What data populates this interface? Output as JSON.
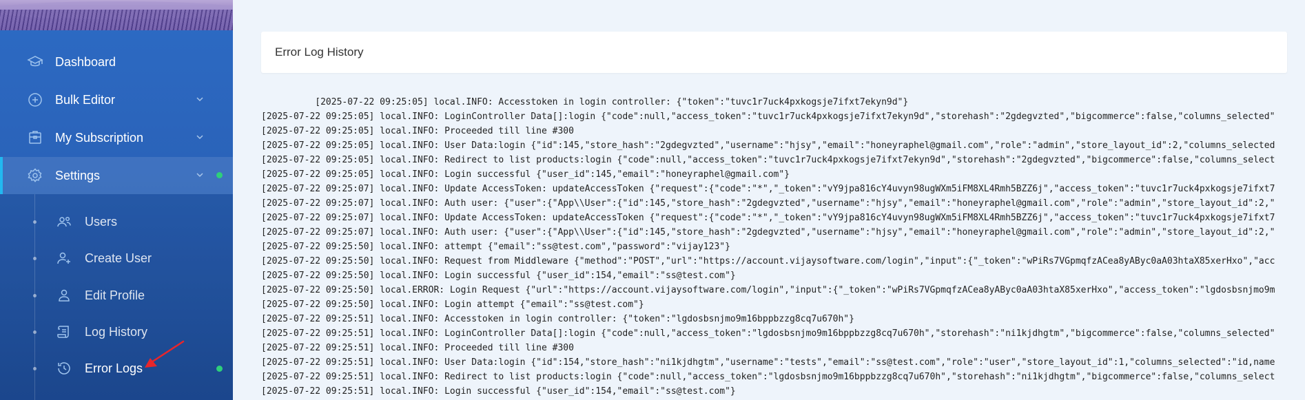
{
  "sidebar": {
    "nav": [
      {
        "label": "Dashboard",
        "icon": "graduation-cap-icon"
      },
      {
        "label": "Bulk Editor",
        "icon": "plus-circle-icon"
      },
      {
        "label": "My Subscription",
        "icon": "briefcase-icon"
      },
      {
        "label": "Settings",
        "icon": "gear-icon"
      }
    ],
    "settings_sub": [
      {
        "label": "Users",
        "icon": "users-icon"
      },
      {
        "label": "Create User",
        "icon": "add-user-icon"
      },
      {
        "label": "Edit Profile",
        "icon": "user-icon"
      },
      {
        "label": "Log History",
        "icon": "scroll-icon"
      },
      {
        "label": "Error Logs",
        "icon": "history-icon"
      }
    ],
    "active_item": "Settings",
    "current_sub": "Error Logs",
    "indicator_color": "#2ecf7a"
  },
  "main": {
    "card_title": "Error Log History",
    "log_lines": [
      "          [2025-07-22 09:25:05] local.INFO: Accesstoken in login controller: {\"token\":\"tuvc1r7uck4pxkogsje7ifxt7ekyn9d\"}",
      "[2025-07-22 09:25:05] local.INFO: LoginController Data[]:login {\"code\":null,\"access_token\":\"tuvc1r7uck4pxkogsje7ifxt7ekyn9d\",\"storehash\":\"2gdegvzted\",\"bigcommerce\":false,\"columns_selected\"",
      "[2025-07-22 09:25:05] local.INFO: Proceeded till line #300",
      "[2025-07-22 09:25:05] local.INFO: User Data:login {\"id\":145,\"store_hash\":\"2gdegvzted\",\"username\":\"hjsy\",\"email\":\"honeyraphel@gmail.com\",\"role\":\"admin\",\"store_layout_id\":2,\"columns_selected",
      "[2025-07-22 09:25:05] local.INFO: Redirect to list products:login {\"code\":null,\"access_token\":\"tuvc1r7uck4pxkogsje7ifxt7ekyn9d\",\"storehash\":\"2gdegvzted\",\"bigcommerce\":false,\"columns_select",
      "[2025-07-22 09:25:05] local.INFO: Login successful {\"user_id\":145,\"email\":\"honeyraphel@gmail.com\"}",
      "[2025-07-22 09:25:07] local.INFO: Update AccessToken: updateAccessToken {\"request\":{\"code\":\"*\",\"_token\":\"vY9jpa816cY4uvyn98ugWXm5iFM8XL4Rmh5BZZ6j\",\"access_token\":\"tuvc1r7uck4pxkogsje7ifxt7",
      "[2025-07-22 09:25:07] local.INFO: Auth user: {\"user\":{\"App\\\\User\":{\"id\":145,\"store_hash\":\"2gdegvzted\",\"username\":\"hjsy\",\"email\":\"honeyraphel@gmail.com\",\"role\":\"admin\",\"store_layout_id\":2,\"",
      "[2025-07-22 09:25:07] local.INFO: Update AccessToken: updateAccessToken {\"request\":{\"code\":\"*\",\"_token\":\"vY9jpa816cY4uvyn98ugWXm5iFM8XL4Rmh5BZZ6j\",\"access_token\":\"tuvc1r7uck4pxkogsje7ifxt7",
      "[2025-07-22 09:25:07] local.INFO: Auth user: {\"user\":{\"App\\\\User\":{\"id\":145,\"store_hash\":\"2gdegvzted\",\"username\":\"hjsy\",\"email\":\"honeyraphel@gmail.com\",\"role\":\"admin\",\"store_layout_id\":2,\"",
      "[2025-07-22 09:25:50] local.INFO: attempt {\"email\":\"ss@test.com\",\"password\":\"vijay123\"}",
      "[2025-07-22 09:25:50] local.INFO: Request from Middleware {\"method\":\"POST\",\"url\":\"https://account.vijaysoftware.com/login\",\"input\":{\"_token\":\"wPiRs7VGpmqfzACea8yAByc0aA03htaX85xerHxo\",\"acc",
      "[2025-07-22 09:25:50] local.INFO: Login successful {\"user_id\":154,\"email\":\"ss@test.com\"}",
      "[2025-07-22 09:25:50] local.ERROR: Login Request {\"url\":\"https://account.vijaysoftware.com/login\",\"input\":{\"_token\":\"wPiRs7VGpmqfzACea8yAByc0aA03htaX85xerHxo\",\"access_token\":\"lgdosbsnjmo9m",
      "[2025-07-22 09:25:50] local.INFO: Login attempt {\"email\":\"ss@test.com\"}",
      "[2025-07-22 09:25:51] local.INFO: Accesstoken in login controller: {\"token\":\"lgdosbsnjmo9m16bppbzzg8cq7u670h\"}",
      "[2025-07-22 09:25:51] local.INFO: LoginController Data[]:login {\"code\":null,\"access_token\":\"lgdosbsnjmo9m16bppbzzg8cq7u670h\",\"storehash\":\"ni1kjdhgtm\",\"bigcommerce\":false,\"columns_selected\"",
      "[2025-07-22 09:25:51] local.INFO: Proceeded till line #300",
      "[2025-07-22 09:25:51] local.INFO: User Data:login {\"id\":154,\"store_hash\":\"ni1kjdhgtm\",\"username\":\"tests\",\"email\":\"ss@test.com\",\"role\":\"user\",\"store_layout_id\":1,\"columns_selected\":\"id,name",
      "[2025-07-22 09:25:51] local.INFO: Redirect to list products:login {\"code\":null,\"access_token\":\"lgdosbsnjmo9m16bppbzzg8cq7u670h\",\"storehash\":\"ni1kjdhgtm\",\"bigcommerce\":false,\"columns_select",
      "[2025-07-22 09:25:51] local.INFO: Login successful {\"user_id\":154,\"email\":\"ss@test.com\"}"
    ]
  },
  "annotation": {
    "arrow_color": "#e8262b",
    "icon": "red-arrow-icon"
  }
}
